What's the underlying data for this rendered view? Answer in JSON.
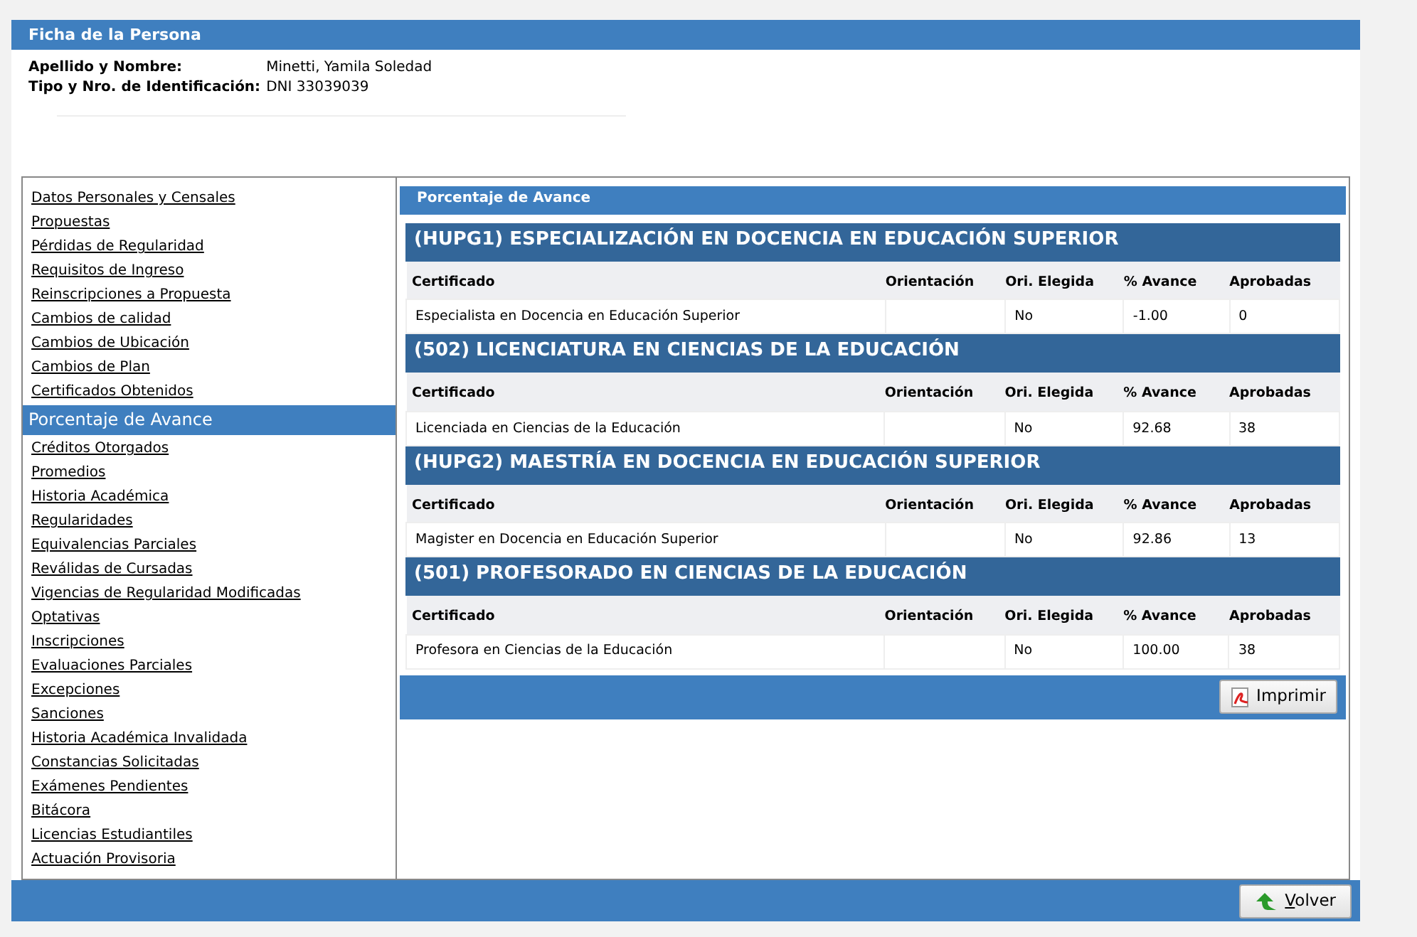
{
  "panel": {
    "title": "Ficha de la Persona"
  },
  "person": [
    {
      "label": "Apellido y Nombre:",
      "value": "Minetti, Yamila Soledad"
    },
    {
      "label": "Tipo y Nro. de Identificación:",
      "value": "DNI 33039039"
    }
  ],
  "sidebar": {
    "items": [
      {
        "label": "Datos Personales y Censales",
        "selected": false
      },
      {
        "label": "Propuestas",
        "selected": false
      },
      {
        "label": "Pérdidas de Regularidad",
        "selected": false
      },
      {
        "label": "Requisitos de Ingreso",
        "selected": false
      },
      {
        "label": "Reinscripciones a Propuesta",
        "selected": false
      },
      {
        "label": "Cambios de calidad",
        "selected": false
      },
      {
        "label": "Cambios de Ubicación",
        "selected": false
      },
      {
        "label": "Cambios de Plan",
        "selected": false
      },
      {
        "label": "Certificados Obtenidos",
        "selected": false
      },
      {
        "label": "Porcentaje de Avance",
        "selected": true
      },
      {
        "label": "Créditos Otorgados",
        "selected": false
      },
      {
        "label": "Promedios",
        "selected": false
      },
      {
        "label": "Historia Académica",
        "selected": false
      },
      {
        "label": "Regularidades",
        "selected": false
      },
      {
        "label": "Equivalencias Parciales",
        "selected": false
      },
      {
        "label": "Reválidas de Cursadas",
        "selected": false
      },
      {
        "label": "Vigencias de Regularidad Modificadas",
        "selected": false
      },
      {
        "label": "Optativas",
        "selected": false
      },
      {
        "label": "Inscripciones",
        "selected": false
      },
      {
        "label": "Evaluaciones Parciales",
        "selected": false
      },
      {
        "label": "Excepciones",
        "selected": false
      },
      {
        "label": "Sanciones",
        "selected": false
      },
      {
        "label": "Historia Académica Invalidada",
        "selected": false
      },
      {
        "label": "Constancias Solicitadas",
        "selected": false
      },
      {
        "label": "Exámenes Pendientes",
        "selected": false
      },
      {
        "label": "Bitácora",
        "selected": false
      },
      {
        "label": "Licencias Estudiantiles",
        "selected": false
      },
      {
        "label": "Actuación Provisoria",
        "selected": false
      }
    ]
  },
  "content": {
    "title": "Porcentaje de Avance",
    "programs": [
      {
        "title": "(HUPG1) ESPECIALIZACIÓN EN DOCENCIA EN EDUCACIÓN SUPERIOR",
        "columns": [
          "Certificado",
          "Orientación",
          "Ori. Elegida",
          "% Avance",
          "Aprobadas"
        ],
        "rows": [
          [
            "Especialista en Docencia en Educación Superior",
            "",
            "No",
            "-1.00",
            "0"
          ]
        ]
      },
      {
        "title": "(502) LICENCIATURA EN CIENCIAS DE LA EDUCACIÓN",
        "columns": [
          "Certificado",
          "Orientación",
          "Ori. Elegida",
          "% Avance",
          "Aprobadas"
        ],
        "rows": [
          [
            "Licenciada en Ciencias de la Educación",
            "",
            "No",
            "92.68",
            "38"
          ]
        ]
      },
      {
        "title": "(HUPG2) MAESTRÍA EN DOCENCIA EN EDUCACIÓN SUPERIOR",
        "columns": [
          "Certificado",
          "Orientación",
          "Ori. Elegida",
          "% Avance",
          "Aprobadas"
        ],
        "rows": [
          [
            "Magister en Docencia en Educación Superior",
            "",
            "No",
            "92.86",
            "13"
          ]
        ]
      },
      {
        "title": "(501) PROFESORADO EN CIENCIAS DE LA EDUCACIÓN",
        "columns": [
          "Certificado",
          "Orientación",
          "Ori. Elegida",
          "% Avance",
          "Aprobadas"
        ],
        "rows": [
          [
            "Profesora en Ciencias de la Educación",
            "",
            "No",
            "100.00",
            "38"
          ]
        ]
      }
    ],
    "print_button": "Imprimir"
  },
  "back_button": "Volver"
}
